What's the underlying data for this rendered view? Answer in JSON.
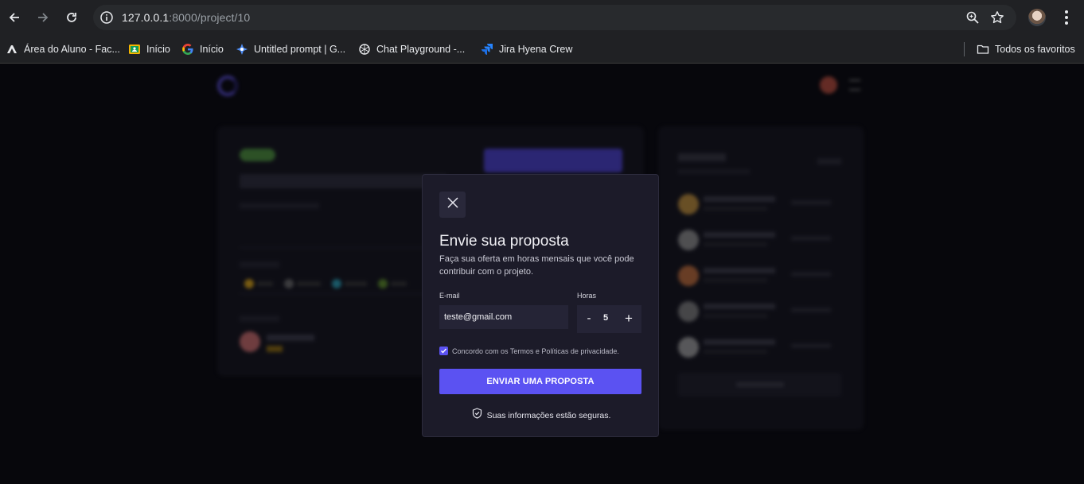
{
  "browser": {
    "url_host": "127.0.0.1",
    "url_rest": ":8000/project/10",
    "bookmarks": [
      {
        "label": "Área do Aluno - Fac...",
        "icon": "alura-icon"
      },
      {
        "label": "Início",
        "icon": "classroom-icon"
      },
      {
        "label": "Início",
        "icon": "google-icon"
      },
      {
        "label": "Untitled prompt | G...",
        "icon": "ai-studio-icon"
      },
      {
        "label": "Chat Playground -...",
        "icon": "openai-icon"
      },
      {
        "label": "Jira Hyena Crew",
        "icon": "jira-icon"
      }
    ],
    "all_bookmarks": "Todos os favoritos"
  },
  "modal": {
    "title": "Envie sua proposta",
    "description": "Faça sua oferta em horas mensais que você pode contribuir com o projeto.",
    "email_label": "E-mail",
    "email_value": "teste@gmail.com",
    "hours_label": "Horas",
    "hours_value": "5",
    "minus": "-",
    "plus": "+",
    "agree_text": "Concordo com os Termos e Políticas de privacidade.",
    "agree_checked": true,
    "submit_label": "ENVIAR UMA PROPOSTA",
    "secure_text": "Suas informações estão seguras."
  },
  "colors": {
    "accent": "#5b52f2",
    "modal_bg": "#1c1b29",
    "page_bg": "#07070c"
  }
}
